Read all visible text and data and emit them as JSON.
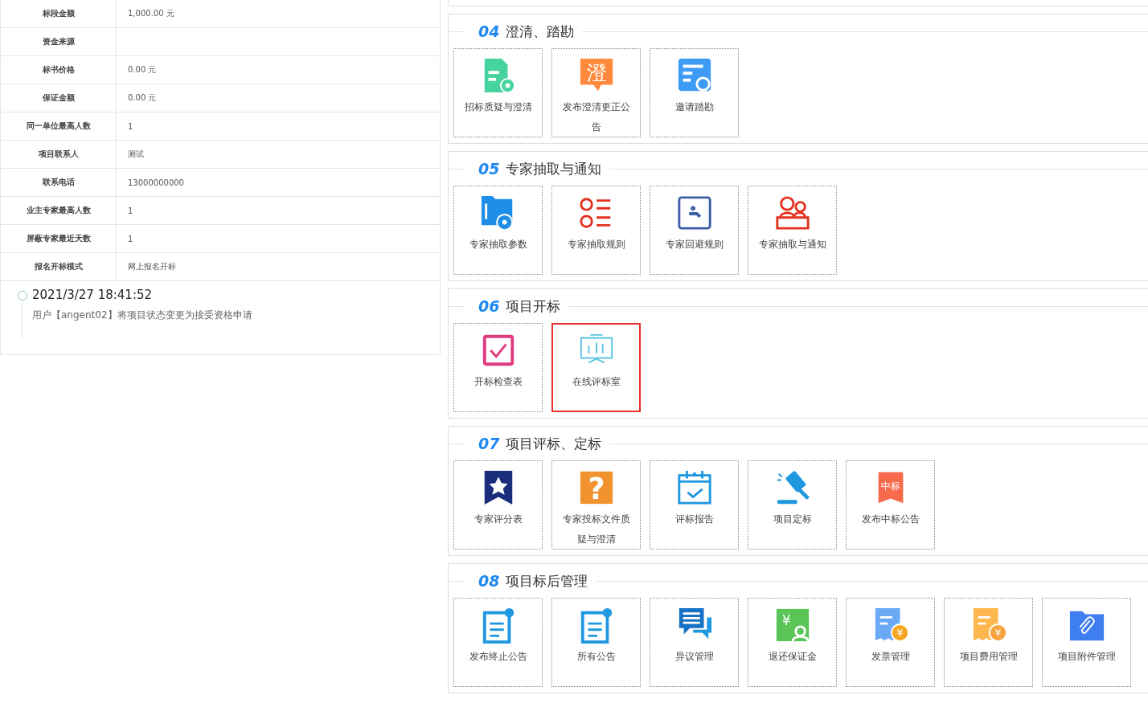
{
  "info_table": [
    {
      "label": "标段金额",
      "value": "1,000.00 元"
    },
    {
      "label": "资金来源"
    },
    {
      "label": "标书价格",
      "value": "0.00 元"
    },
    {
      "label": "保证金额",
      "value": "0.00 元"
    },
    {
      "label": "同一单位最高人数",
      "value": "1"
    },
    {
      "label": "项目联系人",
      "value": "测试"
    },
    {
      "label": "联系电话",
      "value": "13000000000"
    },
    {
      "label": "业主专家最高人数",
      "value": "1"
    },
    {
      "label": "屏蔽专家最近天数",
      "value": "1"
    },
    {
      "label": "报名开标模式",
      "value": "网上报名开标"
    }
  ],
  "timeline": [
    {
      "time": "2021/3/27 18:41:52",
      "text": "用户【angent02】将项目状态变更为接受资格申请"
    }
  ],
  "sections": [
    {
      "number": "04",
      "title": "澄清、踏勘",
      "tiles": [
        {
          "label": "招标质疑与澄清",
          "kind": "document",
          "selected": false
        },
        {
          "label": "发布澄清更正公告",
          "kind": "bubble",
          "glyph": "澄",
          "selected": false
        },
        {
          "label": "邀请踏勘",
          "kind": "search",
          "selected": false
        }
      ]
    },
    {
      "number": "05",
      "title": "专家抽取与通知",
      "tiles": [
        {
          "label": "专家抽取参数",
          "kind": "folder",
          "selected": false
        },
        {
          "label": "专家抽取规则",
          "kind": "list",
          "selected": false
        },
        {
          "label": "专家回避规则",
          "kind": "frame",
          "selected": false
        },
        {
          "label": "专家抽取与通知",
          "kind": "group",
          "selected": false
        }
      ]
    },
    {
      "number": "06",
      "title": "项目开标",
      "tiles": [
        {
          "label": "开标检查表",
          "kind": "checkbox",
          "selected": false
        },
        {
          "label": "在线评标室",
          "kind": "board",
          "selected": true
        }
      ]
    },
    {
      "number": "07",
      "title": "项目评标、定标",
      "tiles": [
        {
          "label": "专家评分表",
          "kind": "bookmark",
          "selected": false
        },
        {
          "label": "专家投标文件质疑与澄清",
          "kind": "question",
          "glyph": "?",
          "selected": false
        },
        {
          "label": "评标报告",
          "kind": "calendar",
          "selected": false
        },
        {
          "label": "项目定标",
          "kind": "gavel",
          "selected": false
        },
        {
          "label": "发布中标公告",
          "kind": "ribbon",
          "glyph": "中标",
          "selected": false
        }
      ]
    },
    {
      "number": "08",
      "title": "项目标后管理",
      "tiles": [
        {
          "label": "发布终止公告",
          "kind": "clipboard",
          "selected": false
        },
        {
          "label": "所有公告",
          "kind": "clipboard",
          "selected": false
        },
        {
          "label": "异议管理",
          "kind": "chat",
          "selected": false
        },
        {
          "label": "退还保证金",
          "kind": "money",
          "glyph": "¥",
          "selected": false
        },
        {
          "label": "发票管理",
          "kind": "receipt",
          "glyph": "¥",
          "selected": false
        },
        {
          "label": "项目费用管理",
          "kind": "invoice",
          "glyph": "¥",
          "selected": false
        },
        {
          "label": "项目附件管理",
          "kind": "attachment",
          "selected": false
        }
      ]
    }
  ]
}
